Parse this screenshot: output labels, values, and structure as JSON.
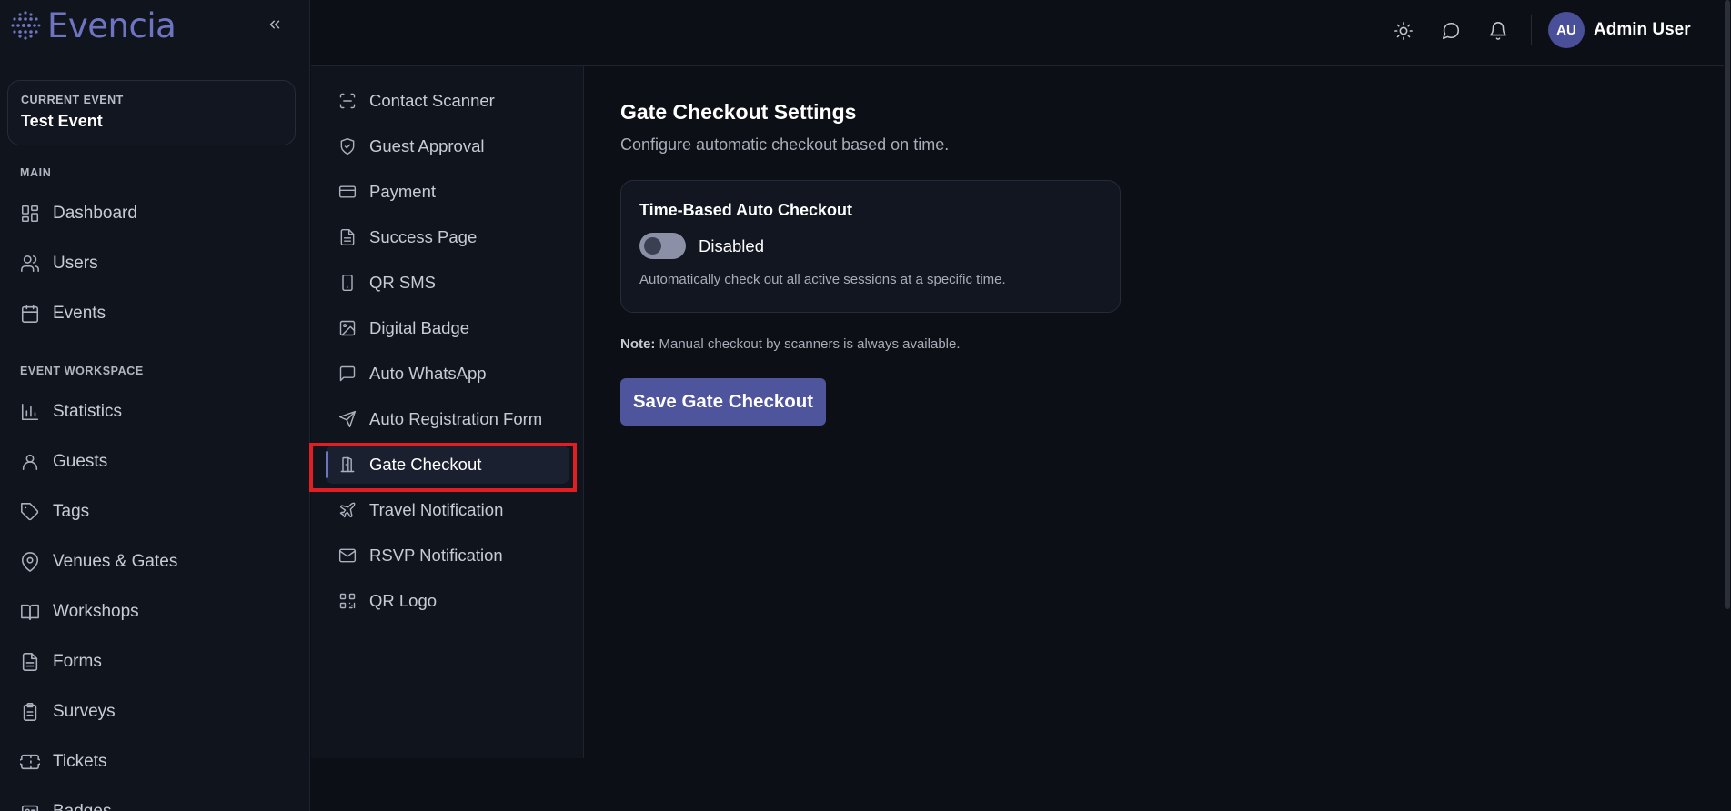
{
  "brand": {
    "name": "Evencia",
    "accent": "#6f74c2"
  },
  "current_event": {
    "label": "CURRENT EVENT",
    "name": "Test Event"
  },
  "sidebar": {
    "main_label": "MAIN",
    "main_items": [
      {
        "label": "Dashboard",
        "icon": "dashboard-icon"
      },
      {
        "label": "Users",
        "icon": "users-icon"
      },
      {
        "label": "Events",
        "icon": "calendar-icon"
      }
    ],
    "workspace_label": "EVENT WORKSPACE",
    "workspace_items": [
      {
        "label": "Statistics",
        "icon": "bar-chart-icon"
      },
      {
        "label": "Guests",
        "icon": "user-icon"
      },
      {
        "label": "Tags",
        "icon": "tag-icon"
      },
      {
        "label": "Venues & Gates",
        "icon": "map-pin-icon"
      },
      {
        "label": "Workshops",
        "icon": "book-icon"
      },
      {
        "label": "Forms",
        "icon": "file-text-icon"
      },
      {
        "label": "Surveys",
        "icon": "clipboard-icon"
      },
      {
        "label": "Tickets",
        "icon": "ticket-icon"
      },
      {
        "label": "Badges",
        "icon": "badge-icon"
      }
    ]
  },
  "topbar": {
    "avatar_initials": "AU",
    "user_name": "Admin User"
  },
  "subnav": {
    "items": [
      {
        "label": "Contact Scanner",
        "icon": "scan-icon"
      },
      {
        "label": "Guest Approval",
        "icon": "shield-check-icon"
      },
      {
        "label": "Payment",
        "icon": "credit-card-icon"
      },
      {
        "label": "Success Page",
        "icon": "file-icon"
      },
      {
        "label": "QR SMS",
        "icon": "smartphone-icon"
      },
      {
        "label": "Digital Badge",
        "icon": "image-icon"
      },
      {
        "label": "Auto WhatsApp",
        "icon": "message-square-icon"
      },
      {
        "label": "Auto Registration Form",
        "icon": "send-icon"
      },
      {
        "label": "Gate Checkout",
        "icon": "door-icon"
      },
      {
        "label": "Travel Notification",
        "icon": "plane-icon"
      },
      {
        "label": "RSVP Notification",
        "icon": "mail-icon"
      },
      {
        "label": "QR Logo",
        "icon": "qr-code-icon"
      }
    ],
    "active_index": 8
  },
  "content": {
    "title": "Gate Checkout Settings",
    "subtitle": "Configure automatic checkout based on time.",
    "card": {
      "title": "Time-Based Auto Checkout",
      "toggle_state": "Disabled",
      "toggle_on": false,
      "description": "Automatically check out all active sessions at a specific time."
    },
    "note_label": "Note:",
    "note_text": " Manual checkout by scanners is always available.",
    "save_label": "Save Gate Checkout"
  }
}
